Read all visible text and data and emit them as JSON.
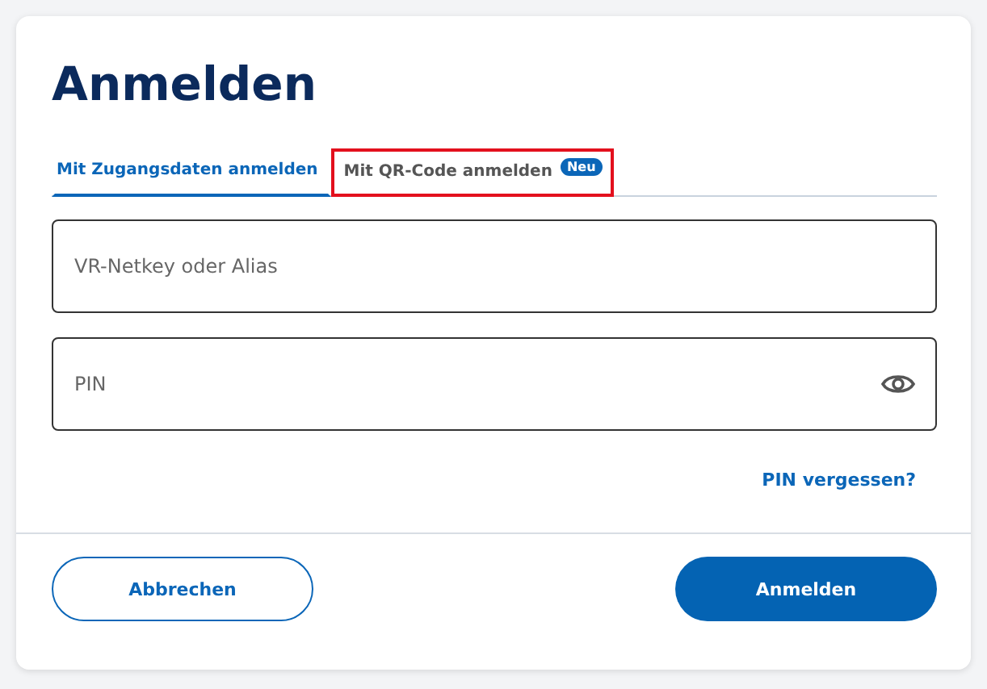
{
  "title": "Anmelden",
  "tabs": [
    {
      "label": "Mit Zugangsdaten anmelden",
      "selected": true,
      "highlighted": false
    },
    {
      "label": "Mit QR-Code anmelden",
      "badge": "Neu",
      "selected": false,
      "highlighted": true
    }
  ],
  "fields": [
    {
      "placeholder": "VR-Netkey oder Alias",
      "kind": "text"
    },
    {
      "placeholder": "PIN",
      "kind": "password"
    }
  ],
  "forgot_link": "PIN vergessen?",
  "buttons": [
    {
      "label": "Abbrechen",
      "kind": "secondary"
    },
    {
      "label": "Anmelden",
      "kind": "primary"
    }
  ]
}
